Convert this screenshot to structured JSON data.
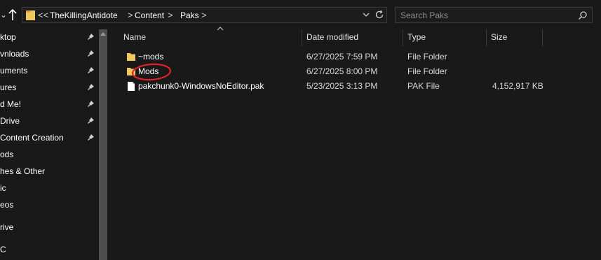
{
  "addressbar": {
    "overflow_label": "<<",
    "crumbs": [
      "TheKillingAntidote",
      "Content",
      "Paks"
    ],
    "separator": ">"
  },
  "search": {
    "placeholder": "Search Paks"
  },
  "navigation": {
    "items": [
      {
        "label": "ktop",
        "pinned": true
      },
      {
        "label": "vnloads",
        "pinned": true
      },
      {
        "label": "uments",
        "pinned": true
      },
      {
        "label": "ures",
        "pinned": true
      },
      {
        "label": "d Me!",
        "pinned": true
      },
      {
        "label": "Drive",
        "pinned": true
      },
      {
        "label": "Content Creation",
        "pinned": true
      },
      {
        "label": "ods",
        "pinned": false
      },
      {
        "label": "hes & Other",
        "pinned": false
      },
      {
        "label": "ic",
        "pinned": false
      },
      {
        "label": "eos",
        "pinned": false
      },
      {
        "label": "rive",
        "pinned": false
      },
      {
        "label": "C",
        "pinned": false
      }
    ]
  },
  "columns": {
    "name": "Name",
    "date_modified": "Date modified",
    "type": "Type",
    "size": "Size"
  },
  "files": [
    {
      "name": "~mods",
      "date": "6/27/2025 7:59 PM",
      "type": "File Folder",
      "size": "",
      "icon": "folder-icon"
    },
    {
      "name": "Mods",
      "date": "6/27/2025 8:00 PM",
      "type": "File Folder",
      "size": "",
      "icon": "folder-icon"
    },
    {
      "name": "pakchunk0-WindowsNoEditor.pak",
      "date": "5/23/2025 3:13 PM",
      "type": "PAK File",
      "size": "4,152,917 KB",
      "icon": "file-icon"
    }
  ],
  "colors": {
    "background": "#191919",
    "folder": "#f0c95c",
    "annotation": "#e0202a"
  }
}
